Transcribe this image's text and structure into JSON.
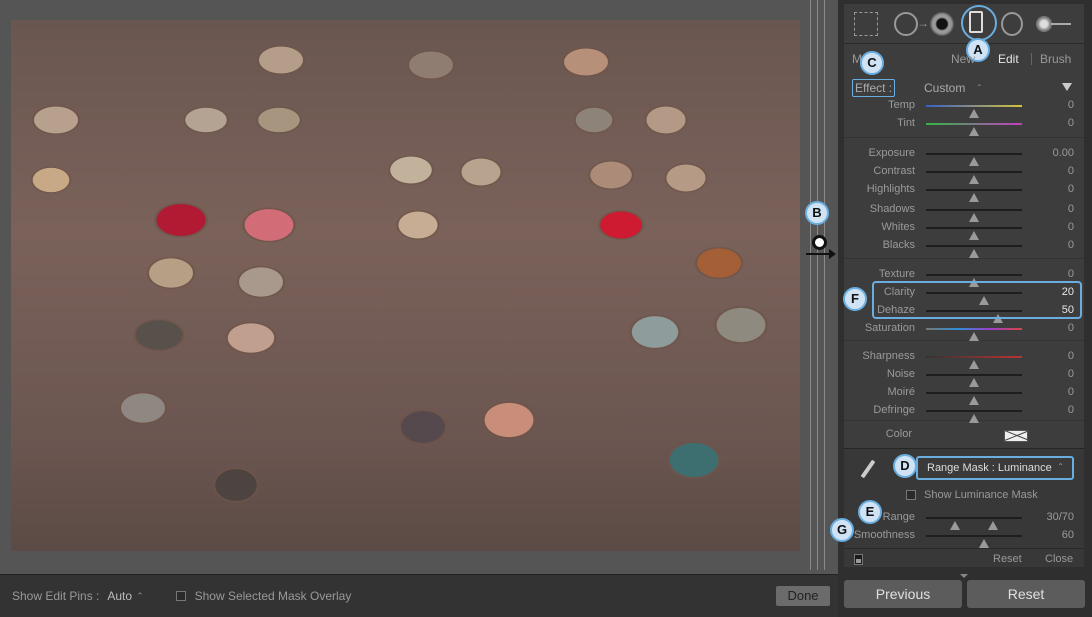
{
  "viewer": {
    "toolbar": {
      "show_edit_pins_label": "Show Edit Pins :",
      "show_edit_pins_value": "Auto",
      "chevron": "⌃",
      "show_overlay_label": "Show Selected Mask Overlay",
      "done_label": "Done"
    }
  },
  "panel": {
    "tabs": {
      "new": "New",
      "edit": "Edit",
      "brush": "Brush",
      "mask_prefix": "M"
    },
    "effect": {
      "label": "Effect :",
      "preset": "Custom",
      "preset_chev": "⌃"
    },
    "sliders": {
      "temp": {
        "label": "Temp",
        "value": "0",
        "pos": 0.5
      },
      "tint": {
        "label": "Tint",
        "value": "0",
        "pos": 0.5
      },
      "exposure": {
        "label": "Exposure",
        "value": "0.00",
        "pos": 0.5
      },
      "contrast": {
        "label": "Contrast",
        "value": "0",
        "pos": 0.5
      },
      "highlights": {
        "label": "Highlights",
        "value": "0",
        "pos": 0.5
      },
      "shadows": {
        "label": "Shadows",
        "value": "0",
        "pos": 0.5
      },
      "whites": {
        "label": "Whites",
        "value": "0",
        "pos": 0.5
      },
      "blacks": {
        "label": "Blacks",
        "value": "0",
        "pos": 0.5
      },
      "texture": {
        "label": "Texture",
        "value": "0",
        "pos": 0.5
      },
      "clarity": {
        "label": "Clarity",
        "value": "20",
        "pos": 0.6
      },
      "dehaze": {
        "label": "Dehaze",
        "value": "50",
        "pos": 0.75
      },
      "saturation": {
        "label": "Saturation",
        "value": "0",
        "pos": 0.5
      },
      "sharpness": {
        "label": "Sharpness",
        "value": "0",
        "pos": 0.5
      },
      "noise": {
        "label": "Noise",
        "value": "0",
        "pos": 0.5
      },
      "moire": {
        "label": "Moiré",
        "value": "0",
        "pos": 0.5
      },
      "defringe": {
        "label": "Defringe",
        "value": "0",
        "pos": 0.5
      }
    },
    "color": {
      "label": "Color"
    },
    "range_mask": {
      "dropdown": "Range Mask : Luminance",
      "chev": "⌃",
      "show_luminance_label": "Show Luminance Mask",
      "range": {
        "label": "Range",
        "value": "30/70",
        "lo": 0.3,
        "hi": 0.7
      },
      "smoothness": {
        "label": "Smoothness",
        "value": "60",
        "pos": 0.6
      }
    },
    "footer": {
      "reset": "Reset",
      "close": "Close"
    },
    "buttons": {
      "previous": "Previous",
      "reset": "Reset"
    }
  },
  "callouts": {
    "a": "A",
    "b": "B",
    "c": "C",
    "d": "D",
    "e": "E",
    "f": "F",
    "g": "G"
  },
  "colors": {
    "accent": "#6aaee0",
    "callout_fill": "#cfe3f5"
  }
}
